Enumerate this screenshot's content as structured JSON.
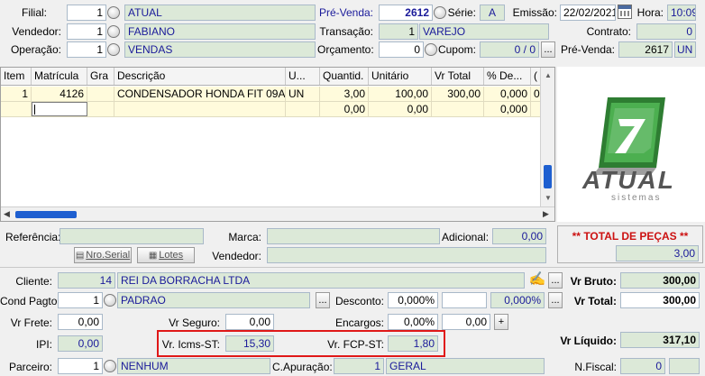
{
  "header": {
    "filial_label": "Filial:",
    "filial_code": "1",
    "filial_name": "ATUAL",
    "vendedor_label": "Vendedor:",
    "vendedor_code": "1",
    "vendedor_name": "FABIANO",
    "operacao_label": "Operação:",
    "operacao_code": "1",
    "operacao_name": "VENDAS",
    "prevenda_label": "Pré-Venda:",
    "prevenda_value": "2612",
    "serie_label": "Série:",
    "serie_value": "A",
    "emissao_label": "Emissão:",
    "emissao_value": "22/02/2021",
    "hora_label": "Hora:",
    "hora_value": "10:09",
    "transacao_label": "Transação:",
    "transacao_code": "1",
    "transacao_name": "VAREJO",
    "contrato_label": "Contrato:",
    "contrato_value": "0",
    "orcamento_label": "Orçamento:",
    "orcamento_value": "0",
    "cupom_label": "Cupom:",
    "cupom_value": "0 / 0",
    "prevenda2_label": "Pré-Venda:",
    "prevenda2_value": "2617",
    "prevenda2_unit": "UN",
    "ellipsis": "..."
  },
  "grid": {
    "columns": [
      "Item",
      "Matrícula",
      "Gra",
      "Descrição",
      "U...",
      "Quantid.",
      "Unitário",
      "Vr Total",
      "% De...",
      "("
    ],
    "rows": [
      [
        "1",
        "4126",
        "",
        "CONDENSADOR HONDA FIT 09A...",
        "UN",
        "3,00",
        "100,00",
        "300,00",
        "0,000",
        "0"
      ],
      [
        "",
        "",
        "",
        "",
        "",
        "0,00",
        "0,00",
        "",
        "0,000",
        ""
      ]
    ]
  },
  "logo": {
    "brand": "ATUAL",
    "sub": "sistemas"
  },
  "middle": {
    "referencia_label": "Referência:",
    "marca_label": "Marca:",
    "adicional_label": "Adicional:",
    "adicional_value": "0,00",
    "vendedor_label": "Vendedor:",
    "nro_serial_label": "Nro.Serial",
    "lotes_label": "Lotes",
    "total_pecas_label": "** TOTAL DE PEÇAS **",
    "total_pecas_value": "3,00"
  },
  "bottom": {
    "cliente_label": "Cliente:",
    "cliente_code": "14",
    "cliente_name": "REI DA BORRACHA LTDA",
    "cond_pagto_label": "Cond Pagto:",
    "cond_pagto_code": "1",
    "cond_pagto_name": "PADRAO",
    "desconto_label": "Desconto:",
    "desconto_pct": "0,000%",
    "desconto_pct2": "0,000%",
    "vr_frete_label": "Vr Frete:",
    "vr_frete_value": "0,00",
    "vr_seguro_label": "Vr Seguro:",
    "vr_seguro_value": "0,00",
    "encargos_label": "Encargos:",
    "encargos_pct": "0,00%",
    "encargos_value": "0,00",
    "ipi_label": "IPI:",
    "ipi_value": "0,00",
    "icms_st_label": "Vr. Icms-ST:",
    "icms_st_value": "15,30",
    "fcp_st_label": "Vr. FCP-ST:",
    "fcp_st_value": "1,80",
    "parceiro_label": "Parceiro:",
    "parceiro_code": "1",
    "parceiro_name": "NENHUM",
    "capuracao_label": "C.Apuração:",
    "capuracao_code": "1",
    "capuracao_name": "GERAL",
    "vr_bruto_label": "Vr Bruto:",
    "vr_bruto_value": "300,00",
    "vr_total_label": "Vr Total:",
    "vr_total_value": "300,00",
    "vr_liquido_label": "Vr Líquido:",
    "vr_liquido_value": "317,10",
    "nfiscal_label": "N.Fiscal:",
    "nfiscal_value": "0",
    "plus": "+"
  },
  "colors": {
    "accent_blue": "#1a1a9a",
    "field_green": "#dce9d8",
    "highlight_red": "#e01818",
    "total_red": "#cc1111"
  }
}
